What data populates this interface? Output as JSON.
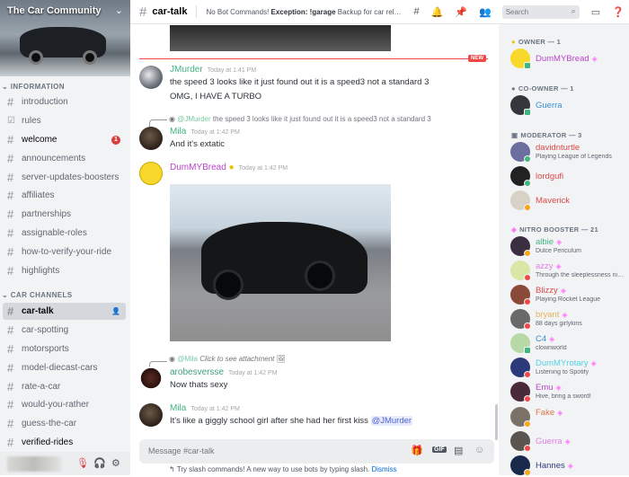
{
  "server": {
    "name": "The Car Community"
  },
  "sidebar": {
    "categories": [
      {
        "label": "INFORMATION",
        "channels": [
          {
            "name": "introduction",
            "icon": "hash-icon"
          },
          {
            "name": "rules",
            "icon": "checkbox-icon"
          },
          {
            "name": "welcome",
            "icon": "hash-icon",
            "badge": "1"
          },
          {
            "name": "announcements",
            "icon": "hash-icon"
          },
          {
            "name": "server-updates-boosters",
            "icon": "hash-icon"
          },
          {
            "name": "affiliates",
            "icon": "hash-icon"
          },
          {
            "name": "partnerships",
            "icon": "hash-icon"
          },
          {
            "name": "assignable-roles",
            "icon": "hash-icon"
          },
          {
            "name": "how-to-verify-your-ride",
            "icon": "hash-icon"
          },
          {
            "name": "highlights",
            "icon": "hash-icon"
          }
        ]
      },
      {
        "label": "CAR CHANNELS",
        "channels": [
          {
            "name": "car-talk",
            "icon": "hash-icon",
            "active": true
          },
          {
            "name": "car-spotting",
            "icon": "hash-icon"
          },
          {
            "name": "motorsports",
            "icon": "hash-icon"
          },
          {
            "name": "model-diecast-cars",
            "icon": "hash-icon"
          },
          {
            "name": "rate-a-car",
            "icon": "hash-icon"
          },
          {
            "name": "would-you-rather",
            "icon": "hash-icon"
          },
          {
            "name": "guess-the-car",
            "icon": "hash-icon"
          },
          {
            "name": "verified-rides",
            "icon": "hash-icon"
          }
        ]
      }
    ]
  },
  "header": {
    "channel": "car-talk",
    "topic_prefix": "No Bot Commands! ",
    "topic_bold": "Exception: !garage",
    "topic_rest": " Backup for car relate...",
    "search_placeholder": "Search"
  },
  "chat": {
    "new_label": "NEW",
    "messages": [
      {
        "author": "JMurder",
        "color": "#43b581",
        "time": "Today at 1:41 PM",
        "lines": [
          "the speed 3 looks like it just found out it is a speed3 not a standard 3",
          "OMG, I HAVE A TURBO"
        ]
      },
      {
        "reply_to": "@JMurder",
        "reply_text": " the speed 3 looks like it just found out it is a speed3 not a standard 3",
        "author": "Mila",
        "color": "#43b581",
        "time": "Today at 1:42 PM",
        "lines": [
          "And it's extatic"
        ]
      },
      {
        "author": "DumMYBread",
        "color": "#b845c8",
        "time": "Today at 1:42 PM",
        "lines": []
      },
      {
        "reply_to": "@Mila",
        "reply_text": " Click to see attachment",
        "author": "arobesversse",
        "color": "#3fa07a",
        "time": "Today at 1:42 PM",
        "lines": [
          "Now thats sexy"
        ]
      },
      {
        "author": "Mila",
        "color": "#43b581",
        "time": "Today at 1:42 PM",
        "lines": [
          "It's like a giggly school girl after she had her first kiss "
        ],
        "mention": "@JMurder"
      }
    ],
    "input_placeholder": "Message #car-talk",
    "hint": "Try slash commands! A new way to use bots by typing slash. ",
    "dismiss": "Dismiss"
  },
  "members": {
    "groups": [
      {
        "label": "OWNER — 1"
      },
      {
        "label": "CO-OWNER — 1"
      },
      {
        "label": "MODERATOR — 3"
      },
      {
        "label": "NITRO BOOSTER — 21"
      }
    ],
    "list": [
      {
        "name": "DumMYBread",
        "color": "#b845c8",
        "status": "",
        "boost": true
      },
      {
        "name": "Guerra",
        "color": "#3b8fd1",
        "status": ""
      },
      {
        "name": "davidnturtle",
        "color": "#d94a4a",
        "status": "Playing League of Legends"
      },
      {
        "name": "lordgufi",
        "color": "#d94a4a",
        "status": ""
      },
      {
        "name": "Maverick",
        "color": "#d94a4a",
        "status": ""
      },
      {
        "name": "albie",
        "color": "#43b581",
        "status": "Dulce Periculum",
        "boost": true
      },
      {
        "name": "azzy",
        "color": "#e07fe6",
        "status": "Through the sleeplessness nig...",
        "boost": true
      },
      {
        "name": "Blizzy",
        "color": "#d94a4a",
        "status": "Playing Rocket League",
        "boost": true
      },
      {
        "name": "bryant",
        "color": "#e5b35a",
        "status": "88 days girlykins",
        "boost": true
      },
      {
        "name": "C4",
        "color": "#3b8fd1",
        "status": "clownworld",
        "boost": true
      },
      {
        "name": "DumMYrotary",
        "color": "#4fd2e6",
        "status": "Listening to Spotify",
        "boost": true
      },
      {
        "name": "Emu",
        "color": "#b845c8",
        "status": "Hive, bring a sword!",
        "boost": true
      },
      {
        "name": "Fake",
        "color": "#e0734a",
        "status": "",
        "boost": true
      },
      {
        "name": "Guerra",
        "color": "#e07fe6",
        "status": "",
        "boost": true
      },
      {
        "name": "Hannes",
        "color": "#2e3b80",
        "status": "",
        "boost": true
      }
    ]
  },
  "colors": {
    "accent": "#5865f2",
    "unread": "#f04747",
    "online": "#43b581",
    "dnd": "#f04747",
    "idle": "#faa61a"
  }
}
